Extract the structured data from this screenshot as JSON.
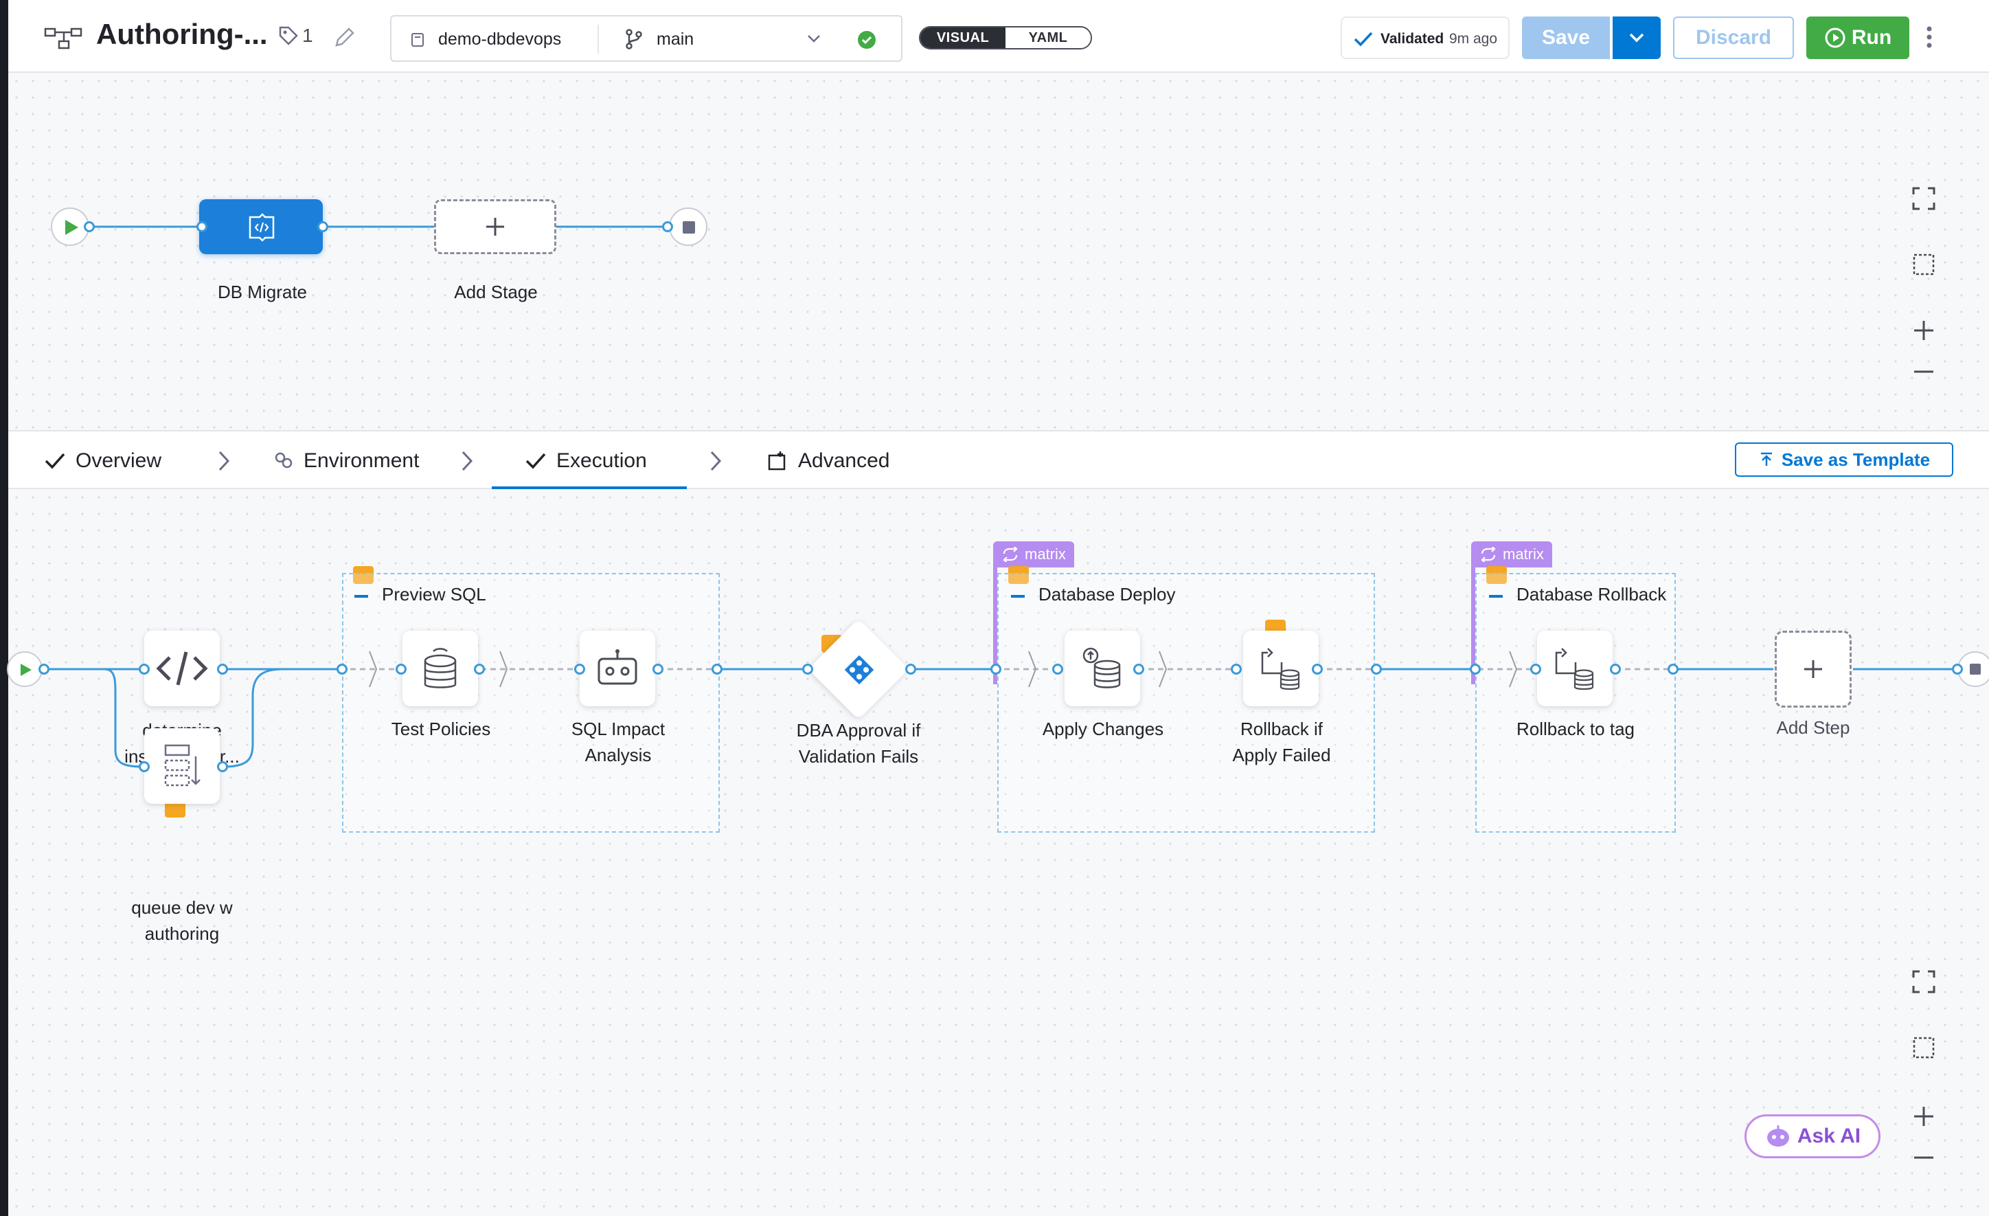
{
  "header": {
    "title": "Authoring-...",
    "tag_count": "1",
    "repo": "demo-dbdevops",
    "branch": "main",
    "view_visual": "VISUAL",
    "view_yaml": "YAML",
    "validated_label": "Validated",
    "validated_time": "9m ago",
    "save_label": "Save",
    "discard_label": "Discard",
    "run_label": "Run"
  },
  "stages": {
    "db_migrate": "DB Migrate",
    "add_stage": "Add Stage"
  },
  "tabs": {
    "overview": "Overview",
    "environment": "Environment",
    "execution": "Execution",
    "advanced": "Advanced",
    "save_template": "Save as Template"
  },
  "steps": {
    "determine": [
      "determine",
      "instances for..."
    ],
    "queue": [
      "queue dev w",
      "authoring"
    ],
    "preview_group": "Preview SQL",
    "test_policies": "Test Policies",
    "sql_impact": [
      "SQL Impact",
      "Analysis"
    ],
    "dba_approval": [
      "DBA Approval if",
      "Validation Fails"
    ],
    "deploy_group": "Database Deploy",
    "apply_changes": "Apply Changes",
    "rollback_if": [
      "Rollback if",
      "Apply Failed"
    ],
    "rollback_group": "Database Rollback",
    "rollback_tag": "Rollback to tag",
    "add_step": "Add Step",
    "matrix_label": "matrix"
  },
  "ask_ai": "Ask AI",
  "colors": {
    "accent": "#0278d5",
    "save_disabled": "#9fc6ee",
    "run_green": "#42ab45",
    "matrix_purple": "#b58cf0",
    "badge_orange": "#f5a623",
    "edge_blue": "#3b9ad9"
  }
}
